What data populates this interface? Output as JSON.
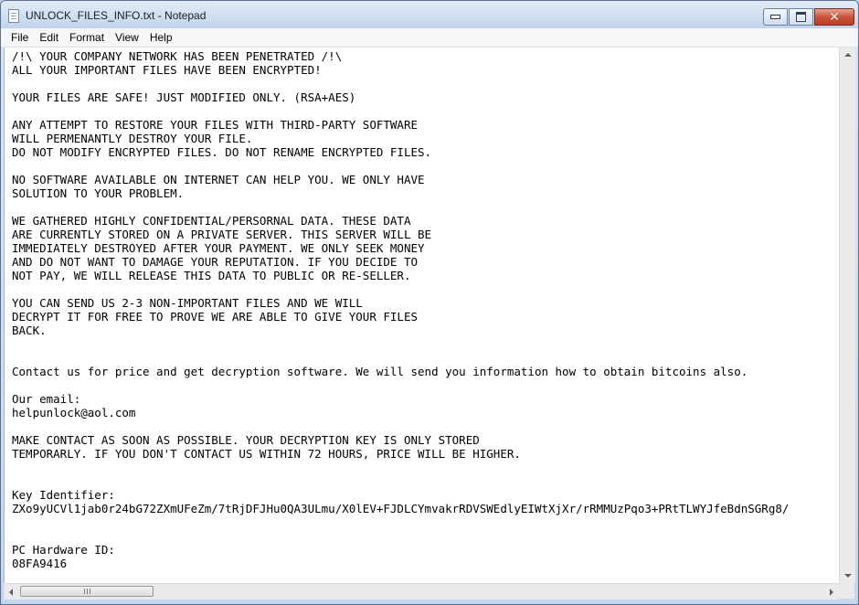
{
  "window": {
    "title": "UNLOCK_FILES_INFO.txt - Notepad"
  },
  "menu": {
    "items": [
      "File",
      "Edit",
      "Format",
      "View",
      "Help"
    ]
  },
  "document": {
    "text": "/!\\ YOUR COMPANY NETWORK HAS BEEN PENETRATED /!\\\nALL YOUR IMPORTANT FILES HAVE BEEN ENCRYPTED!\n\nYOUR FILES ARE SAFE! JUST MODIFIED ONLY. (RSA+AES)\n\nANY ATTEMPT TO RESTORE YOUR FILES WITH THIRD-PARTY SOFTWARE\nWILL PERMENANTLY DESTROY YOUR FILE.\nDO NOT MODIFY ENCRYPTED FILES. DO NOT RENAME ENCRYPTED FILES.\n\nNO SOFTWARE AVAILABLE ON INTERNET CAN HELP YOU. WE ONLY HAVE\nSOLUTION TO YOUR PROBLEM.\n\nWE GATHERED HIGHLY CONFIDENTIAL/PERSORNAL DATA. THESE DATA\nARE CURRENTLY STORED ON A PRIVATE SERVER. THIS SERVER WILL BE\nIMMEDIATELY DESTROYED AFTER YOUR PAYMENT. WE ONLY SEEK MONEY\nAND DO NOT WANT TO DAMAGE YOUR REPUTATION. IF YOU DECIDE TO\nNOT PAY, WE WILL RELEASE THIS DATA TO PUBLIC OR RE-SELLER.\n\nYOU CAN SEND US 2-3 NON-IMPORTANT FILES AND WE WILL\nDECRYPT IT FOR FREE TO PROVE WE ARE ABLE TO GIVE YOUR FILES\nBACK.\n\n\nContact us for price and get decryption software. We will send you information how to obtain bitcoins also.\n\nOur email:\nhelpunlock@aol.com\n\nMAKE CONTACT AS SOON AS POSSIBLE. YOUR DECRYPTION KEY IS ONLY STORED\nTEMPORARLY. IF YOU DON'T CONTACT US WITHIN 72 HOURS, PRICE WILL BE HIGHER.\n\n\nKey Identifier:\nZXo9yUCVl1jab0r24bG72ZXmUFeZm/7tRjDFJHu0QA3ULmu/X0lEV+FJDLCYmvakrRDVSWEdlyEIWtXjXr/rRMMUzPqo3+PRtTLWYJfeBdnSGRg8/\n\n\nPC Hardware ID:\n08FA9416"
  }
}
